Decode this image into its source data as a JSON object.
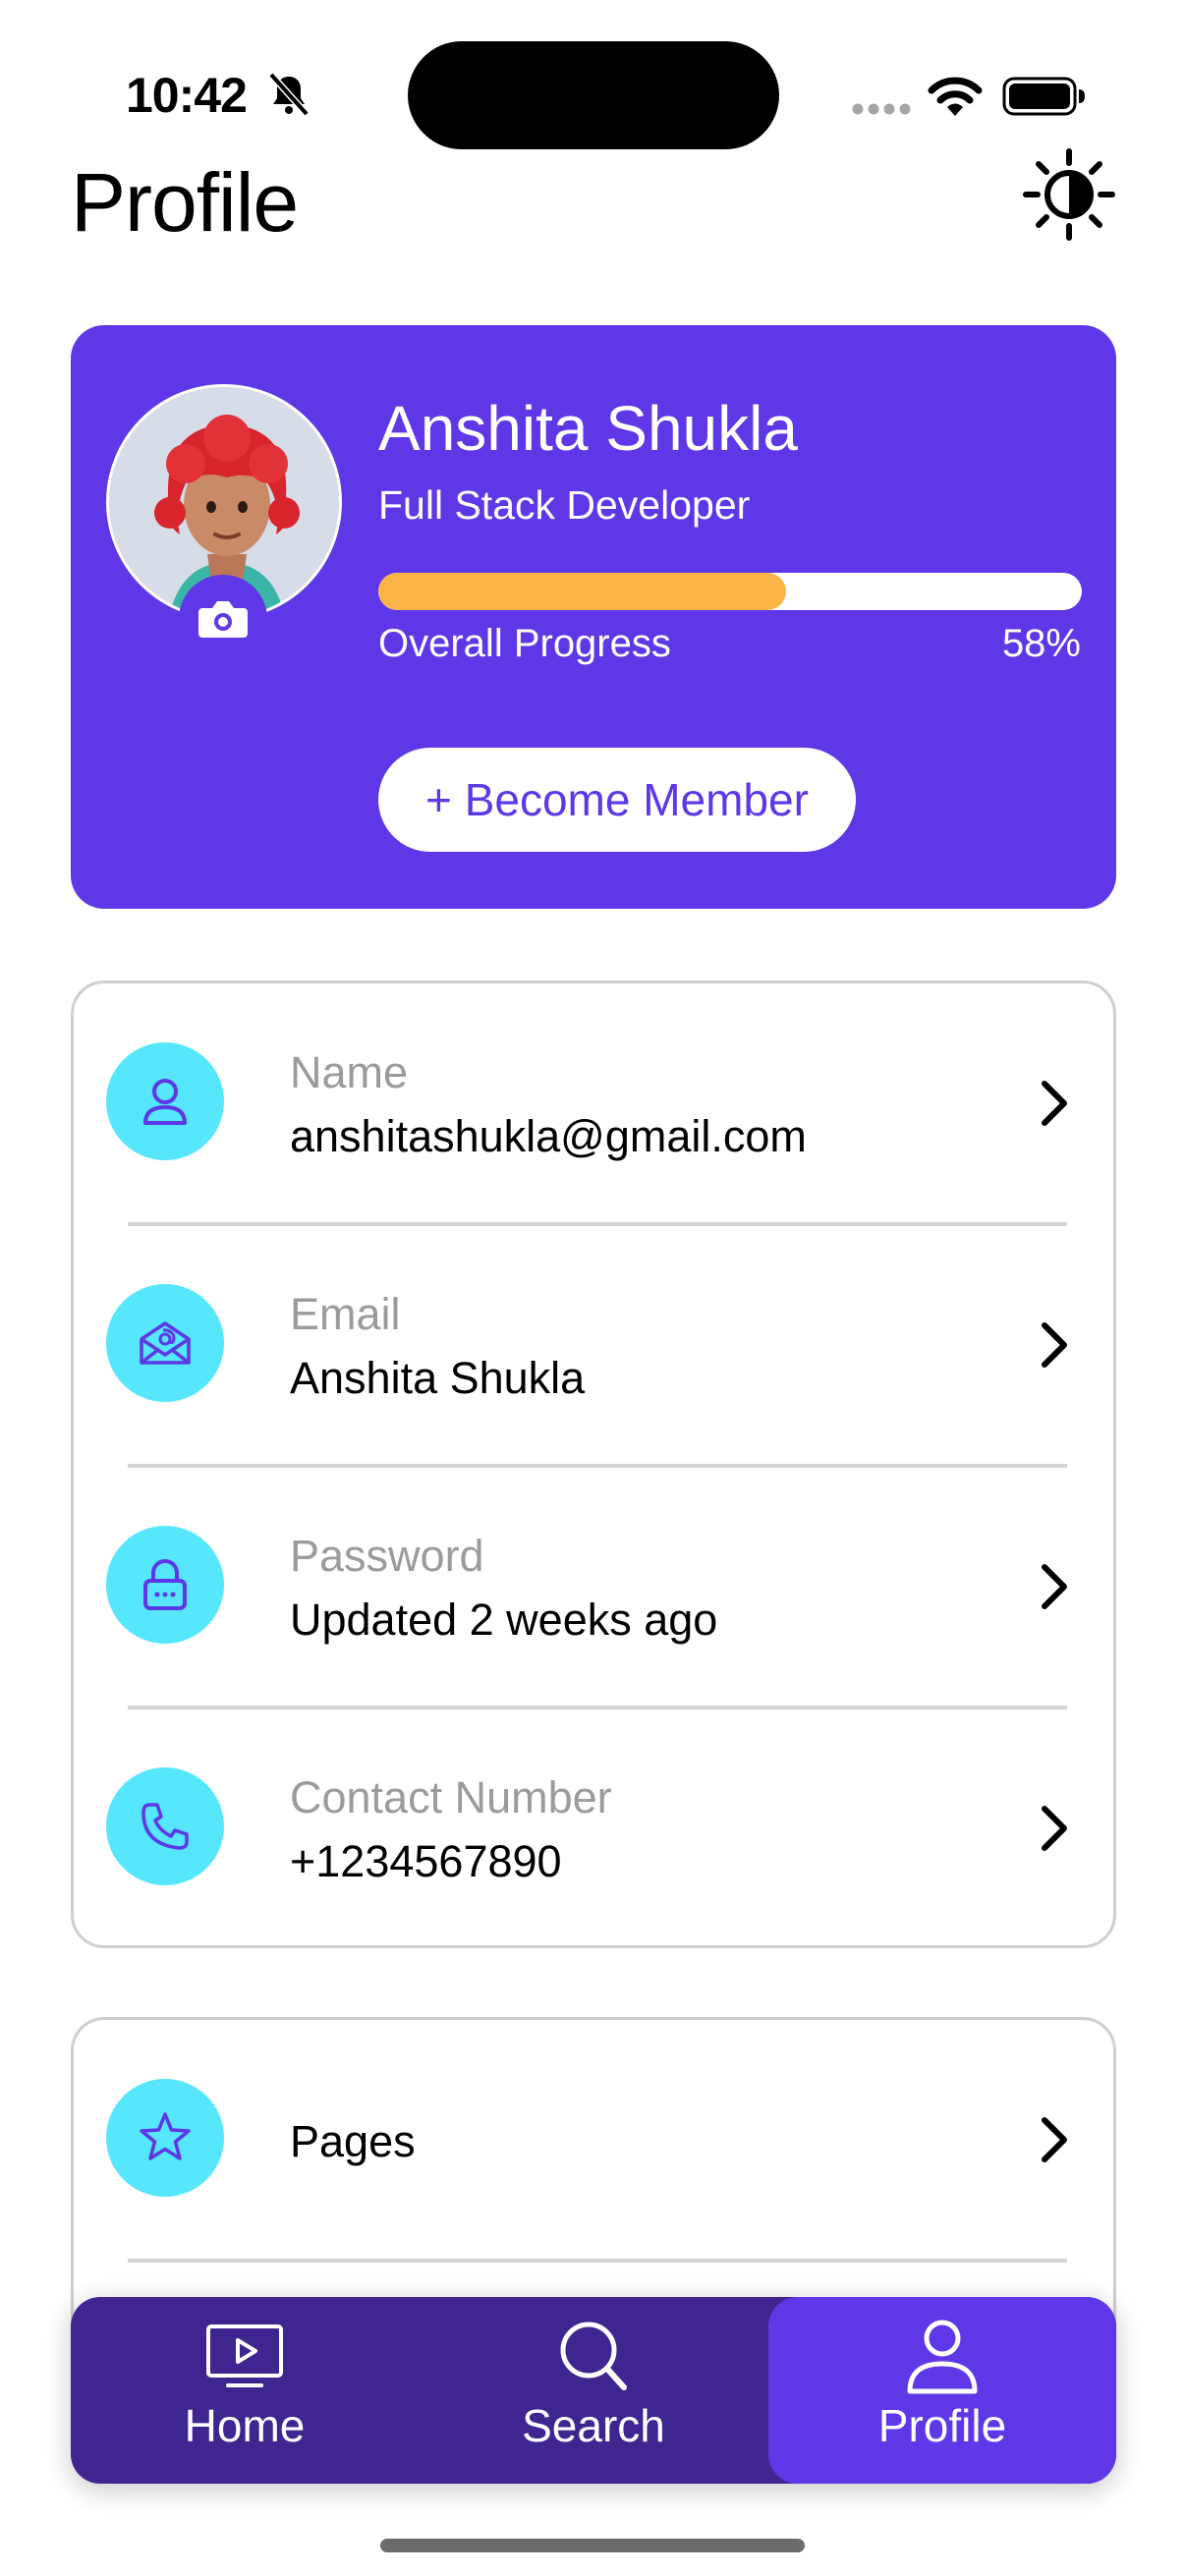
{
  "status_bar": {
    "time": "10:42",
    "icons": [
      "bell-slash-icon",
      "signal-dots-icon",
      "wifi-icon",
      "battery-icon"
    ]
  },
  "header": {
    "title": "Profile",
    "theme_icon": "sun-half-icon"
  },
  "profile": {
    "name": "Anshita Shukla",
    "role": "Full Stack Developer",
    "progress_label": "Overall Progress",
    "progress_text": "58%",
    "progress_value": 0.58,
    "member_button": "+ Become Member",
    "avatar_icon": "avatar-3d",
    "camera_icon": "camera-icon"
  },
  "info_rows": [
    {
      "icon": "user-icon",
      "label": "Name",
      "value": "anshitashukla@gmail.com"
    },
    {
      "icon": "envelope-at-icon",
      "label": "Email",
      "value": "Anshita Shukla"
    },
    {
      "icon": "lock-icon",
      "label": "Password",
      "value": "Updated 2 weeks ago"
    },
    {
      "icon": "phone-icon",
      "label": "Contact Number",
      "value": "+1234567890"
    }
  ],
  "more_rows": [
    {
      "icon": "star-icon",
      "label": "Pages"
    }
  ],
  "tabs": [
    {
      "label": "Home",
      "icon": "tv-play-icon",
      "active": false
    },
    {
      "label": "Search",
      "icon": "magnifier-icon",
      "active": false
    },
    {
      "label": "Profile",
      "icon": "person-icon",
      "active": true
    }
  ],
  "colors": {
    "primary": "#5e37e6",
    "tab_bar": "#3e258f",
    "progress": "#fbb446",
    "icon_bg": "#56e7fc",
    "muted_text": "#9b9b9b"
  }
}
